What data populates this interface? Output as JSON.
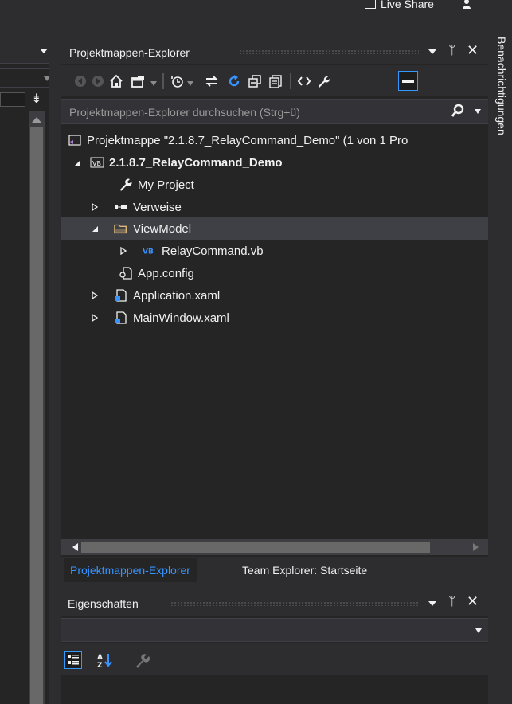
{
  "topbar": {
    "live_share_label": "Live Share"
  },
  "solution_explorer": {
    "title": "Projektmappen-Explorer",
    "search_placeholder": "Projektmappen-Explorer durchsuchen (Strg+ü)",
    "toolbar_icons": [
      "back-icon",
      "forward-icon",
      "home-icon",
      "switch-views-icon",
      "pending-changes-filter-icon",
      "sync-icon",
      "refresh-icon",
      "collapse-all-icon",
      "show-all-files-icon",
      "view-code-icon",
      "properties-wrench-icon",
      "preview-selected-icon"
    ],
    "tree": [
      {
        "label": "Projektmappe \"2.1.8.7_RelayCommand_Demo\" (1 von 1 Pro",
        "icon": "solution-icon",
        "expander": "none",
        "bold": false,
        "selected": false
      },
      {
        "label": "2.1.8.7_RelayCommand_Demo",
        "icon": "vb-project-icon",
        "expander": "expanded",
        "bold": true,
        "selected": false
      },
      {
        "label": "My Project",
        "icon": "wrench-icon",
        "expander": "none",
        "bold": false,
        "selected": false
      },
      {
        "label": "Verweise",
        "icon": "references-icon",
        "expander": "collapsed",
        "bold": false,
        "selected": false
      },
      {
        "label": "ViewModel",
        "icon": "folder-open-icon",
        "expander": "expanded",
        "bold": false,
        "selected": true
      },
      {
        "label": "RelayCommand.vb",
        "icon": "vb-file-icon",
        "expander": "collapsed",
        "bold": false,
        "selected": false
      },
      {
        "label": "App.config",
        "icon": "config-file-icon",
        "expander": "none",
        "bold": false,
        "selected": false
      },
      {
        "label": "Application.xaml",
        "icon": "xaml-file-icon",
        "expander": "collapsed",
        "bold": false,
        "selected": false
      },
      {
        "label": "MainWindow.xaml",
        "icon": "xaml-file-icon",
        "expander": "collapsed",
        "bold": false,
        "selected": false
      }
    ],
    "tabs": [
      {
        "label": "Projektmappen-Explorer",
        "active": true
      },
      {
        "label": "Team Explorer: Startseite",
        "active": false
      }
    ]
  },
  "properties": {
    "title": "Eigenschaften"
  },
  "notifications": {
    "label": "Benachrichtigungen"
  },
  "colors": {
    "background": "#2d2d30",
    "panel": "#252526",
    "accent": "#3794ff",
    "selection": "#3f3f46",
    "text": "#f1f1f1"
  }
}
